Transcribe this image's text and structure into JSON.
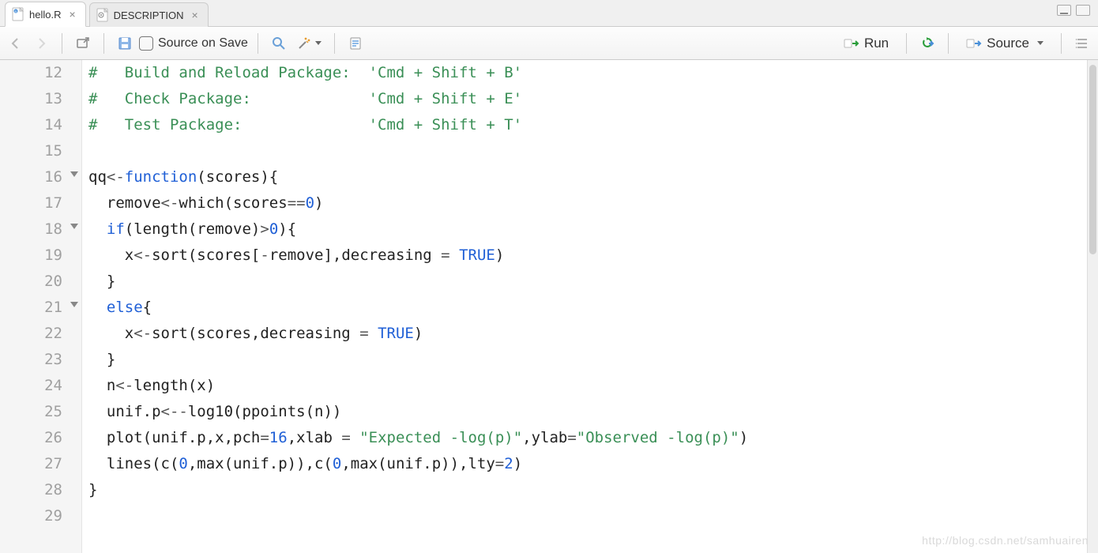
{
  "tabs": [
    {
      "label": "hello.R",
      "active": true,
      "icon": "r-file-icon"
    },
    {
      "label": "DESCRIPTION",
      "active": false,
      "icon": "gear-file-icon"
    }
  ],
  "toolbar": {
    "source_on_save_label": "Source on Save",
    "run_label": "Run",
    "source_label": "Source"
  },
  "code_lines": [
    {
      "n": 12,
      "fold": false,
      "tokens": [
        {
          "t": "#   Build and Reload Package:  'Cmd + Shift + B'",
          "c": "c-comment"
        }
      ]
    },
    {
      "n": 13,
      "fold": false,
      "tokens": [
        {
          "t": "#   Check Package:             'Cmd + Shift + E'",
          "c": "c-comment"
        }
      ]
    },
    {
      "n": 14,
      "fold": false,
      "tokens": [
        {
          "t": "#   Test Package:              'Cmd + Shift + T'",
          "c": "c-comment"
        }
      ]
    },
    {
      "n": 15,
      "fold": false,
      "tokens": []
    },
    {
      "n": 16,
      "fold": true,
      "tokens": [
        {
          "t": "qq",
          "c": ""
        },
        {
          "t": "<-",
          "c": "c-assign"
        },
        {
          "t": "function",
          "c": "c-keyword"
        },
        {
          "t": "(scores){",
          "c": ""
        }
      ]
    },
    {
      "n": 17,
      "fold": false,
      "tokens": [
        {
          "t": "  remove",
          "c": ""
        },
        {
          "t": "<-",
          "c": "c-assign"
        },
        {
          "t": "which(scores",
          "c": ""
        },
        {
          "t": "==",
          "c": "c-assign"
        },
        {
          "t": "0",
          "c": "c-number"
        },
        {
          "t": ")",
          "c": ""
        }
      ]
    },
    {
      "n": 18,
      "fold": true,
      "tokens": [
        {
          "t": "  ",
          "c": ""
        },
        {
          "t": "if",
          "c": "c-keyword"
        },
        {
          "t": "(length(remove)",
          "c": ""
        },
        {
          "t": ">",
          "c": "c-assign"
        },
        {
          "t": "0",
          "c": "c-number"
        },
        {
          "t": "){",
          "c": ""
        }
      ]
    },
    {
      "n": 19,
      "fold": false,
      "tokens": [
        {
          "t": "    x",
          "c": ""
        },
        {
          "t": "<-",
          "c": "c-assign"
        },
        {
          "t": "sort(scores[",
          "c": ""
        },
        {
          "t": "-",
          "c": "c-assign"
        },
        {
          "t": "remove],decreasing ",
          "c": ""
        },
        {
          "t": "=",
          "c": "c-assign"
        },
        {
          "t": " ",
          "c": ""
        },
        {
          "t": "TRUE",
          "c": "c-const"
        },
        {
          "t": ")",
          "c": ""
        }
      ]
    },
    {
      "n": 20,
      "fold": false,
      "tokens": [
        {
          "t": "  }",
          "c": ""
        }
      ]
    },
    {
      "n": 21,
      "fold": true,
      "tokens": [
        {
          "t": "  ",
          "c": ""
        },
        {
          "t": "else",
          "c": "c-keyword"
        },
        {
          "t": "{",
          "c": ""
        }
      ]
    },
    {
      "n": 22,
      "fold": false,
      "tokens": [
        {
          "t": "    x",
          "c": ""
        },
        {
          "t": "<-",
          "c": "c-assign"
        },
        {
          "t": "sort(scores,decreasing ",
          "c": ""
        },
        {
          "t": "=",
          "c": "c-assign"
        },
        {
          "t": " ",
          "c": ""
        },
        {
          "t": "TRUE",
          "c": "c-const"
        },
        {
          "t": ")",
          "c": ""
        }
      ]
    },
    {
      "n": 23,
      "fold": false,
      "tokens": [
        {
          "t": "  }",
          "c": ""
        }
      ]
    },
    {
      "n": 24,
      "fold": false,
      "tokens": [
        {
          "t": "  n",
          "c": ""
        },
        {
          "t": "<-",
          "c": "c-assign"
        },
        {
          "t": "length(x)",
          "c": ""
        }
      ]
    },
    {
      "n": 25,
      "fold": false,
      "tokens": [
        {
          "t": "  unif.p",
          "c": ""
        },
        {
          "t": "<-",
          "c": "c-assign"
        },
        {
          "t": "-",
          "c": "c-assign"
        },
        {
          "t": "log10(ppoints(n))",
          "c": ""
        }
      ]
    },
    {
      "n": 26,
      "fold": false,
      "tokens": [
        {
          "t": "  plot(unif.p,x,pch",
          "c": ""
        },
        {
          "t": "=",
          "c": "c-assign"
        },
        {
          "t": "16",
          "c": "c-number"
        },
        {
          "t": ",xlab ",
          "c": ""
        },
        {
          "t": "=",
          "c": "c-assign"
        },
        {
          "t": " ",
          "c": ""
        },
        {
          "t": "\"Expected -log(p)\"",
          "c": "c-string"
        },
        {
          "t": ",ylab",
          "c": ""
        },
        {
          "t": "=",
          "c": "c-assign"
        },
        {
          "t": "\"Observed -log(p)\"",
          "c": "c-string"
        },
        {
          "t": ")",
          "c": ""
        }
      ]
    },
    {
      "n": 27,
      "fold": false,
      "tokens": [
        {
          "t": "  lines(c(",
          "c": ""
        },
        {
          "t": "0",
          "c": "c-number"
        },
        {
          "t": ",max(unif.p)),c(",
          "c": ""
        },
        {
          "t": "0",
          "c": "c-number"
        },
        {
          "t": ",max(unif.p)),lty",
          "c": ""
        },
        {
          "t": "=",
          "c": "c-assign"
        },
        {
          "t": "2",
          "c": "c-number"
        },
        {
          "t": ")",
          "c": ""
        }
      ]
    },
    {
      "n": 28,
      "fold": false,
      "tokens": [
        {
          "t": "}",
          "c": ""
        }
      ]
    },
    {
      "n": 29,
      "fold": false,
      "tokens": []
    }
  ],
  "watermark": "http://blog.csdn.net/samhuairen"
}
